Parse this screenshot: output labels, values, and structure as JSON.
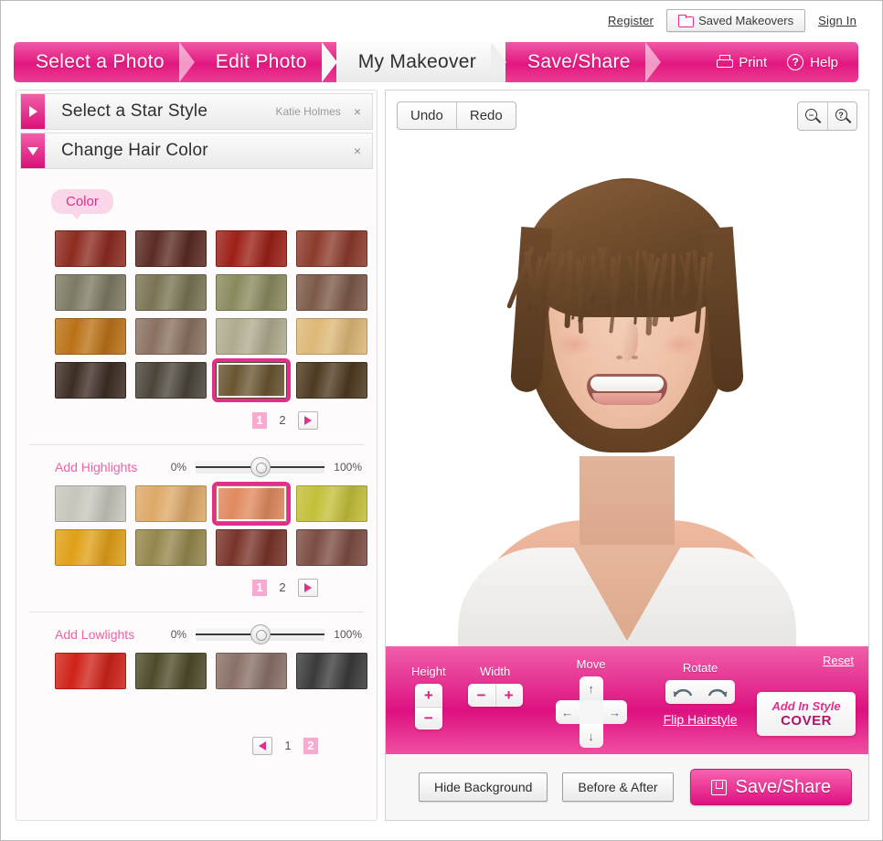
{
  "topbar": {
    "register": "Register",
    "saved_makeovers": "Saved Makeovers",
    "saved_icon": "folder-icon",
    "sign_in": "Sign In"
  },
  "nav": {
    "crumbs": [
      {
        "label": "Select a Photo",
        "active": false
      },
      {
        "label": "Edit Photo",
        "active": false
      },
      {
        "label": "My Makeover",
        "active": true
      },
      {
        "label": "Save/Share",
        "active": false
      }
    ],
    "print": "Print",
    "print_icon": "printer-icon",
    "help": "Help",
    "help_icon": "question-mark-icon",
    "help_glyph": "?"
  },
  "left_panel": {
    "accordions": [
      {
        "title": "Select a Star Style",
        "value": "Katie Holmes",
        "expanded": false,
        "close": "×"
      },
      {
        "title": "Change Hair Color",
        "value": "",
        "expanded": true,
        "close": "×"
      }
    ],
    "color_section": {
      "tag": "Color",
      "swatches": [
        "#8e2b20",
        "#5c2b24",
        "#9c2018",
        "#8c3b2c",
        "#7d7a63",
        "#797453",
        "#8a8a5e",
        "#7c5a48",
        "#ba7216",
        "#8a7160",
        "#b0ab8f",
        "#ddb877",
        "#3e2d24",
        "#4b4539",
        "#6b5532",
        "#4e3a20"
      ],
      "selected_index": 14,
      "pager": {
        "pages": [
          "1",
          "2"
        ],
        "current": "1",
        "next_icon": "chevron-right-icon"
      }
    },
    "highlights_section": {
      "label": "Add Highlights",
      "slider": {
        "min": "0%",
        "max": "100%",
        "value": 50
      },
      "swatches": [
        "#c8c5bb",
        "#dda968",
        "#e08a5e",
        "#c4bf38",
        "#e0a017",
        "#95874c",
        "#79342a",
        "#7d4d42"
      ],
      "selected_index": 2,
      "pager": {
        "pages": [
          "1",
          "2"
        ],
        "current": "1",
        "next_icon": "chevron-right-icon"
      }
    },
    "lowlights_section": {
      "label": "Add Lowlights",
      "slider": {
        "min": "0%",
        "max": "100%",
        "value": 50
      },
      "swatches": [
        "#cf2318",
        "#4f4b2a",
        "#8a7068",
        "#3b3b3c"
      ],
      "selected_index": -1,
      "pager": {
        "pages": [
          "1",
          "2"
        ],
        "current": "2",
        "prev_icon": "chevron-left-icon"
      }
    }
  },
  "photo_panel": {
    "undo": "Undo",
    "redo": "Redo",
    "zoom_out_icon": "zoom-out-icon",
    "zoom_in_icon": "zoom-in-icon",
    "zoom_out_glyph": "−",
    "zoom_in_glyph": "?",
    "subject_alt": "makeover-portrait"
  },
  "toolbar": {
    "height_label": "Height",
    "height_inc": "+",
    "height_dec": "−",
    "width_label": "Width",
    "width_dec": "−",
    "width_inc": "+",
    "move_label": "Move",
    "move_up_icon": "arrow-up-icon",
    "move_down_icon": "arrow-down-icon",
    "move_left_icon": "arrow-left-icon",
    "move_right_icon": "arrow-right-icon",
    "move_up_glyph": "↑",
    "move_down_glyph": "↓",
    "move_left_glyph": "←",
    "move_right_glyph": "→",
    "rotate_label": "Rotate",
    "rotate_ccw_icon": "rotate-counterclockwise-icon",
    "rotate_cw_icon": "rotate-clockwise-icon",
    "flip_hairstyle": "Flip Hairstyle",
    "reset": "Reset",
    "add_in_style_line1": "Add In Style",
    "add_in_style_line2": "COVER"
  },
  "bottombar": {
    "hide_background": "Hide Background",
    "before_after": "Before & After",
    "save_share": "Save/Share",
    "save_icon": "floppy-disk-icon"
  },
  "colors": {
    "accent_pink": "#e0308c",
    "nav_pink": "#dd1180",
    "tag_pink": "#fad7e8",
    "pager_on": "#f9a9d0"
  }
}
